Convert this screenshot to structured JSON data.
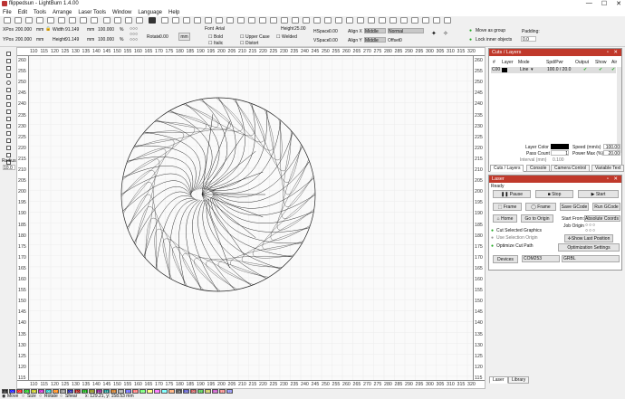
{
  "window": {
    "title": "flippedsun - LightBurn 1.4.00",
    "controls": [
      "—",
      "☐",
      "✕"
    ]
  },
  "menu": [
    "File",
    "Edit",
    "Tools",
    "Arrange",
    "Laser Tools",
    "Window",
    "Language",
    "Help"
  ],
  "props": {
    "xpos_label": "XPos",
    "xpos": "200.000",
    "ypos_label": "YPos",
    "ypos": "200.000",
    "unit": "mm",
    "width_label": "Width",
    "width": "91.149",
    "height_label": "Height",
    "height": "91.149",
    "scale_w": "100.000",
    "scale_h": "100.000",
    "pct": "%",
    "rotate_label": "Rotate",
    "rotate": "0.00",
    "mm_btn": "mm",
    "font_label": "Font",
    "font": "Arial",
    "fheight_label": "Height",
    "fheight": "25.00",
    "hspace_label": "HSpace",
    "hspace": "0.00",
    "vspace_label": "VSpace",
    "vspace": "0.00",
    "alignx_label": "Align X",
    "alignx": "Middle",
    "aligny_label": "Align Y",
    "aligny": "Middle",
    "normal": "Normal",
    "offset_label": "Offset",
    "offset": "0",
    "bold": "Bold",
    "italic": "Italic",
    "upper": "Upper Case",
    "welded": "Welded",
    "distort": "Distort",
    "move_group": "Move as group",
    "lock_inner": "Lock inner objects",
    "padding_label": "Padding:",
    "padding": "0.0"
  },
  "left_tools": {
    "radius_label": "Radius:",
    "radius": "10.0"
  },
  "rulers": {
    "top": [
      "110",
      "115",
      "120",
      "125",
      "130",
      "135",
      "140",
      "145",
      "150",
      "155",
      "160",
      "165",
      "170",
      "175",
      "180",
      "185",
      "190",
      "195",
      "200",
      "205",
      "210",
      "215",
      "220",
      "225",
      "230",
      "235",
      "240",
      "245",
      "250",
      "255",
      "260",
      "265",
      "270",
      "275",
      "280",
      "285",
      "290",
      "295",
      "300",
      "305",
      "310",
      "315",
      "320"
    ],
    "left": [
      "260",
      "255",
      "250",
      "245",
      "240",
      "235",
      "230",
      "225",
      "220",
      "215",
      "210",
      "205",
      "200",
      "195",
      "190",
      "185",
      "180",
      "175",
      "170",
      "165",
      "160",
      "155",
      "150",
      "145",
      "140",
      "135",
      "130",
      "125",
      "120",
      "115"
    ]
  },
  "cuts_layers": {
    "title": "Cuts / Layers",
    "headers": [
      "#",
      "Layer",
      "Mode",
      "Spd/Pwr",
      "Output",
      "Show",
      "Air"
    ],
    "row": {
      "num": "C00",
      "mode": "Line",
      "spdpwr": "100.0 / 20.0"
    },
    "layer_color_label": "Layer Color",
    "speed_label": "Speed (mm/s)",
    "speed": "100.00",
    "pass_label": "Pass Count",
    "pass": "1",
    "power_label": "Power Max (%)",
    "power": "20.00",
    "interval_label": "Interval (mm)",
    "interval": "0.100",
    "tabs": [
      "Cuts / Layers",
      "Console",
      "Camera Control",
      "Variable Text"
    ]
  },
  "laser": {
    "title": "Laser",
    "status": "Ready",
    "pause": "Pause",
    "stop": "Stop",
    "start": "Start",
    "frame1": "Frame",
    "frame2": "Frame",
    "save_gcode": "Save GCode",
    "run_gcode": "Run GCode",
    "home": "Home",
    "goto_origin": "Go to Origin",
    "start_from_label": "Start From:",
    "start_from": "Absolute Coords",
    "job_origin": "Job Origin",
    "cut_selected": "Cut Selected Graphics",
    "use_selection": "Use Selection Origin",
    "show_last": "Show Last Position",
    "optimize_cut": "Optimize Cut Path",
    "opt_settings": "Optimization Settings",
    "devices": "Devices",
    "port": "COM253",
    "controller": "GRBL",
    "tabs": [
      "Laser",
      "Library"
    ]
  },
  "palette": [
    "00",
    "01",
    "02",
    "03",
    "04",
    "05",
    "06",
    "07",
    "08",
    "09",
    "10",
    "11",
    "12",
    "13",
    "14",
    "15",
    "16",
    "17",
    "18",
    "19",
    "20",
    "21",
    "22",
    "23",
    "24",
    "25",
    "26",
    "27",
    "28",
    "29",
    "T1",
    "T2"
  ],
  "palette_colors": [
    "#000000",
    "#0000ff",
    "#ff0000",
    "#00c000",
    "#c0c000",
    "#c000c0",
    "#00c0c0",
    "#ff8000",
    "#808080",
    "#0000a0",
    "#a00000",
    "#00a000",
    "#808000",
    "#800080",
    "#008080",
    "#c06000",
    "#a0a0a0",
    "#6060ff",
    "#ff6060",
    "#60ff60",
    "#ffff60",
    "#ff60ff",
    "#60ffff",
    "#ffa060",
    "#404040",
    "#4040c0",
    "#c04040",
    "#40c040",
    "#c0c040",
    "#c040c0",
    "#f08080",
    "#8080f0"
  ],
  "status": {
    "move": "Move",
    "size": "Size",
    "rotate": "Rotate",
    "shear": "Shear",
    "coords": "x: 129.21, y: 158.53 mm"
  }
}
